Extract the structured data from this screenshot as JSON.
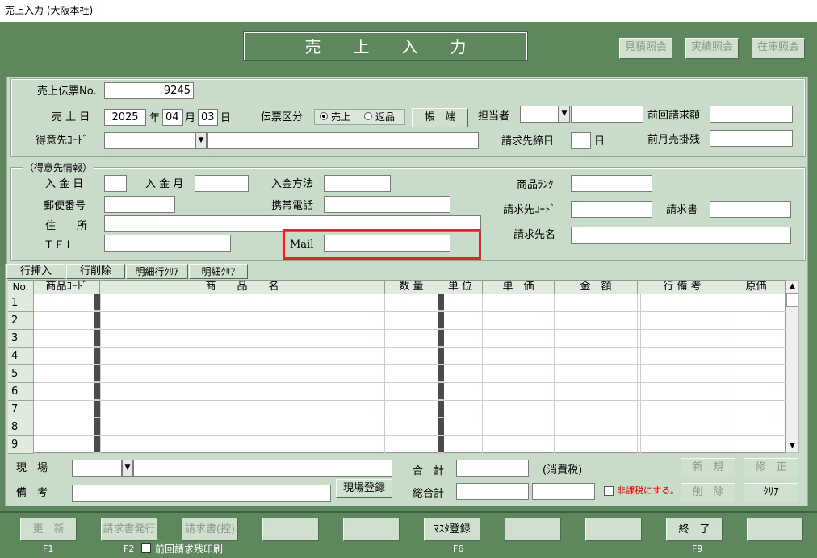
{
  "window_title": "売上入力 (大阪本社)",
  "header": {
    "title": "売　　上　　入　　力",
    "buttons": [
      "見積照会",
      "実績照会",
      "在庫照会"
    ]
  },
  "slip": {
    "slip_no_label": "売上伝票No.",
    "slip_no": "9245",
    "date_label": "売 上 日",
    "year": "2025",
    "year_unit": "年",
    "month": "04",
    "month_unit": "月",
    "day": "03",
    "day_unit": "日",
    "slip_type_label": "伝票区分",
    "slip_type_options": [
      "売上",
      "返品"
    ],
    "slip_type_selected": "売上",
    "ledger_button": "帳　端",
    "staff_label": "担当者",
    "prev_billing_label": "前回請求額",
    "customer_code_label": "得意先ｺｰﾄﾞ",
    "closing_day_label": "請求先締日",
    "closing_day_unit": "日",
    "prev_receivable_label": "前月売掛残"
  },
  "customer_info": {
    "group_label": "（得意先情報）",
    "deposit_day_label": "入 金 日",
    "deposit_month_label": "入 金 月",
    "payment_method_label": "入金方法",
    "product_rank_label": "商品ﾗﾝｸ",
    "postal_label": "郵便番号",
    "mobile_label": "携帯電話",
    "billing_code_label": "請求先ｺｰﾄﾞ",
    "invoice_label": "請求書",
    "address_label": "住　　所",
    "billing_name_label": "請求先名",
    "tel_label": "ＴＥＬ",
    "mail_label": "Mail"
  },
  "grid": {
    "toolbar": [
      "行挿入",
      "行削除",
      "明細行ｸﾘｱ",
      "明細ｸﾘｱ"
    ],
    "columns": [
      "No.",
      "商品ｺｰﾄﾞ",
      "商　　品　　名",
      "数 量",
      "単 位",
      "単　価",
      "金　額",
      "行 備 考",
      "原価"
    ],
    "rows": [
      "1",
      "2",
      "3",
      "4",
      "5",
      "6",
      "7",
      "8",
      "9"
    ]
  },
  "footer": {
    "site_label": "現　場",
    "site_register_button": "現場登録",
    "note_label": "備　考",
    "total_label": "合　計",
    "tax_label": "(消費税)",
    "grand_total_label": "総合計",
    "tax_exempt_label": "非課税にする。",
    "new_button": "新　規",
    "edit_button": "修　正",
    "delete_button": "削　除",
    "clear_button": "ｸﾘｱ"
  },
  "function_bar": {
    "buttons": [
      "更　新",
      "請求書発行",
      "請求書(控)",
      "",
      "",
      "ﾏｽﾀ登録",
      "",
      "",
      "終　了",
      ""
    ],
    "keys": [
      "F1",
      "F2",
      "F6",
      "F9"
    ],
    "prev_unpaid_print_label": "前回請求残印刷"
  },
  "colors": {
    "frame_green": "#5e875e",
    "panel_green": "#c9dbc9",
    "highlight_red": "#e0242a",
    "tax_exempt_red": "#e00000"
  }
}
